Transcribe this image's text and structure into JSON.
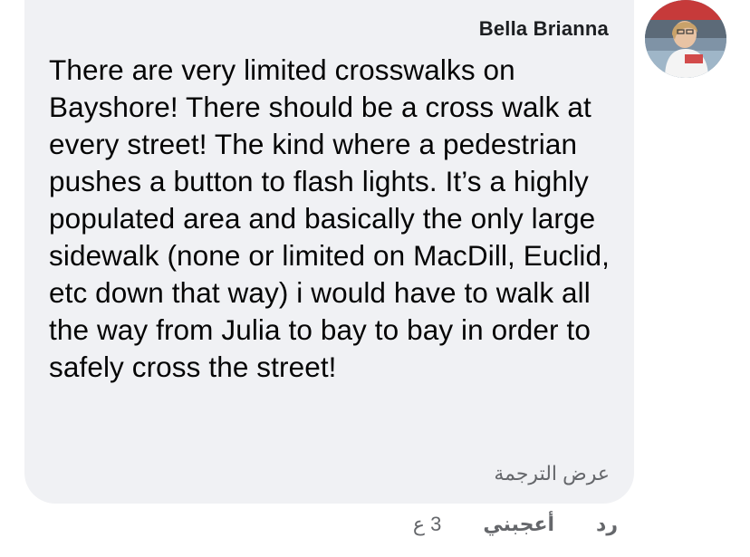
{
  "comment": {
    "author": "Bella Brianna",
    "text": "There are very limited crosswalks on Bayshore! There should be a cross walk at every street! The kind where a pedestrian pushes a button to flash lights. It’s a highly populated area and basically the only large sidewalk (none or limited on MacDill, Euclid, etc down that way) i would have to walk all the way from Julia to bay to bay in order to safely cross the street!",
    "see_translation": "عرض الترجمة"
  },
  "actions": {
    "timestamp": "3 ع",
    "like_label": "أعجبني",
    "reply_label": "رد"
  },
  "colors": {
    "bubble_background": "#f0f1f4",
    "secondary_text": "#65676b",
    "primary_text": "#050505"
  }
}
